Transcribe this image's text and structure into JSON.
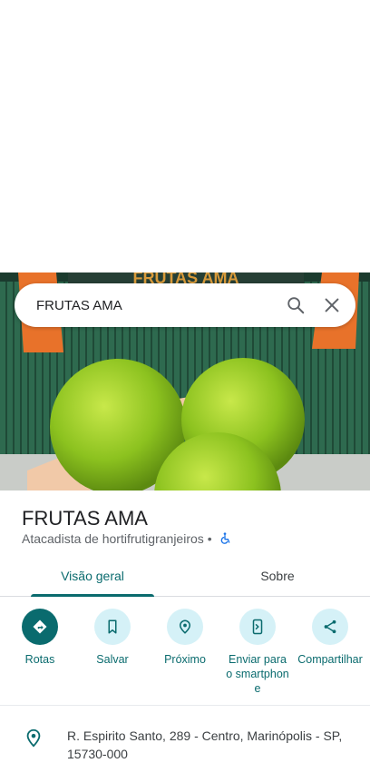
{
  "search": {
    "value": "FRUTAS AMA"
  },
  "hero": {
    "sign_text": "FRUTAS AMA"
  },
  "place": {
    "name": "FRUTAS AMA",
    "category": "Atacadista de hortifrutigranjeiros",
    "separator": "•",
    "accessibility_icon": "wheelchair-icon"
  },
  "tabs": [
    {
      "label": "Visão geral",
      "active": true
    },
    {
      "label": "Sobre",
      "active": false
    }
  ],
  "actions": [
    {
      "label": "Rotas",
      "icon": "directions-icon"
    },
    {
      "label": "Salvar",
      "icon": "bookmark-icon"
    },
    {
      "label": "Próximo",
      "icon": "nearby-icon"
    },
    {
      "label": "Enviar para o smartphone",
      "icon": "send-to-phone-icon"
    },
    {
      "label": "Compartilhar",
      "icon": "share-icon"
    }
  ],
  "address": {
    "text": "R. Espirito Santo, 289 - Centro, Marinópolis - SP, 15730-000",
    "icon": "location-pin-icon"
  },
  "colors": {
    "accent": "#0a6b6e",
    "accent_light": "#d5f1f7",
    "fruit": "#8cc21f",
    "sign": "#e8722a"
  }
}
